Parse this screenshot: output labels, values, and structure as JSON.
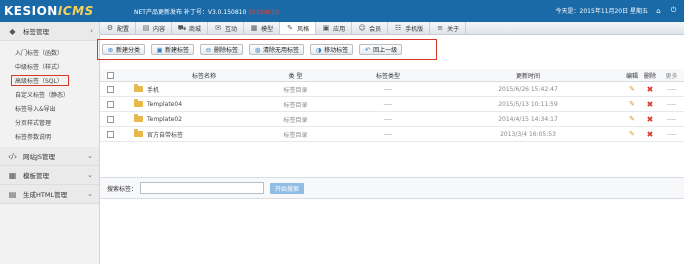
{
  "topbar": {
    "logo_main": "KESION",
    "logo_cms": "ICMS",
    "version_line": "NET产品更新发布  补丁号：V3.0.150810",
    "version_date": "2015/8/10",
    "today": "今天是：2015年11月20日 星期五"
  },
  "nav": [
    {
      "icon": "gear-icon",
      "glyph": "⚙",
      "label": "配置"
    },
    {
      "icon": "document-icon",
      "glyph": "▤",
      "label": "内容"
    },
    {
      "icon": "cart-icon",
      "glyph": "⛟",
      "label": "商城"
    },
    {
      "icon": "chat-icon",
      "glyph": "✉",
      "label": "互动"
    },
    {
      "icon": "template-icon",
      "glyph": "▦",
      "label": "模型"
    },
    {
      "icon": "tag-icon",
      "glyph": "✎",
      "label": "风格"
    },
    {
      "icon": "apps-icon",
      "glyph": "▣",
      "label": "应用"
    },
    {
      "icon": "user-icon",
      "glyph": "☺",
      "label": "会员"
    },
    {
      "icon": "grid-icon",
      "glyph": "☷",
      "label": "手机版"
    },
    {
      "icon": "menu-icon",
      "glyph": "≡",
      "label": "关于"
    }
  ],
  "sidebar": {
    "sections": [
      {
        "label": "标签管理",
        "icon": "tag-icon",
        "glyph": "◆",
        "chevron": "‹"
      },
      {
        "label": "网站JS管理",
        "icon": "code-icon",
        "glyph": "‹/›",
        "chevron": "⌄"
      },
      {
        "label": "模板管理",
        "icon": "template-icon",
        "glyph": "▦",
        "chevron": "⌄"
      },
      {
        "label": "生成HTML管理",
        "icon": "layers-icon",
        "glyph": "▤",
        "chevron": "⌄"
      }
    ],
    "tag_items": [
      "入门标签（函数）",
      "中级标签（样式）",
      "高级标签（SQL）",
      "自定义标签（静态）",
      "标签导入&导出",
      "分页样式管理",
      "标签参数说明"
    ]
  },
  "toolbar": [
    {
      "icon": "add-category-icon",
      "glyph": "⊕",
      "label": "新建分类"
    },
    {
      "icon": "new-tag-icon",
      "glyph": "▣",
      "label": "新建标签"
    },
    {
      "icon": "delete-tag-icon",
      "glyph": "⊖",
      "label": "删除标签"
    },
    {
      "icon": "clean-icon",
      "glyph": "◍",
      "label": "清除无用标签"
    },
    {
      "icon": "move-icon",
      "glyph": "◑",
      "label": "移动标签"
    },
    {
      "icon": "back-icon",
      "glyph": "↶",
      "label": "回上一级"
    }
  ],
  "table": {
    "headers": {
      "name": "标签名称",
      "type": "类 型",
      "template": "标签类型",
      "time": "更新时间",
      "edit": "编辑",
      "delete": "删除",
      "more": "更多"
    },
    "rows": [
      {
        "name": "手机",
        "type": "标签目录",
        "template": "----",
        "time": "2015/6/26 15:42:47",
        "more": "----"
      },
      {
        "name": "Template04",
        "type": "标签目录",
        "template": "----",
        "time": "2015/5/13 10:11:59",
        "more": "----"
      },
      {
        "name": "Template02",
        "type": "标签目录",
        "template": "----",
        "time": "2014/4/15 14:34:17",
        "more": "----"
      },
      {
        "name": "官方自带标签",
        "type": "标签目录",
        "template": "----",
        "time": "2013/3/4 16:05:53",
        "more": "----"
      }
    ]
  },
  "search": {
    "label": "搜索标签：",
    "value": "",
    "button": "开始搜索"
  },
  "colors": {
    "topbar": "#1b6aa8",
    "highlight_border": "#d9362c",
    "folder": "#e8b84a",
    "search_button": "#8fbde3"
  }
}
